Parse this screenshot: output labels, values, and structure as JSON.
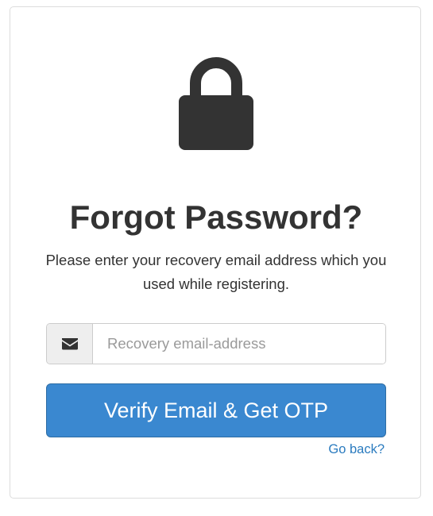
{
  "form": {
    "title": "Forgot Password?",
    "subtitle": "Please enter your recovery email address which you used while registering.",
    "email_input": {
      "placeholder": "Recovery email-address",
      "value": "",
      "icon": "envelope-icon"
    },
    "submit_label": "Verify Email & Get OTP",
    "back_link_label": "Go back?"
  },
  "icons": {
    "header": "lock-icon"
  },
  "colors": {
    "primary_button": "#3a88d0",
    "link": "#2a7bbf",
    "icon": "#333333"
  }
}
